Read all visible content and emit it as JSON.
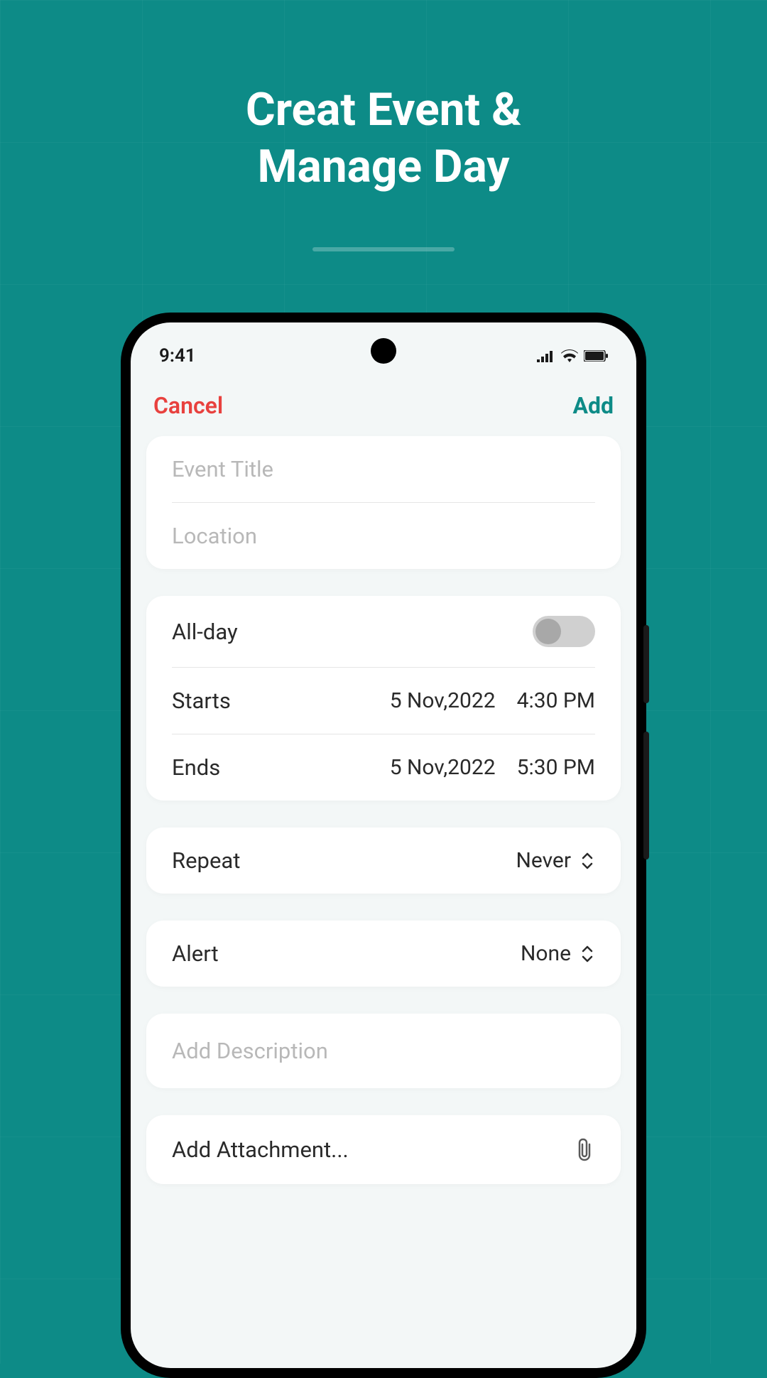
{
  "promo": {
    "headline_line1": "Creat Event &",
    "headline_line2": "Manage Day"
  },
  "status": {
    "time": "9:41"
  },
  "nav": {
    "cancel": "Cancel",
    "add": "Add"
  },
  "fields": {
    "title_placeholder": "Event Title",
    "location_placeholder": "Location",
    "allday_label": "All-day",
    "allday_value": false,
    "starts_label": "Starts",
    "starts_date": "5 Nov,2022",
    "starts_time": "4:30 PM",
    "ends_label": "Ends",
    "ends_date": "5 Nov,2022",
    "ends_time": "5:30 PM",
    "repeat_label": "Repeat",
    "repeat_value": "Never",
    "alert_label": "Alert",
    "alert_value": "None",
    "description_placeholder": "Add Description",
    "attachment_label": "Add Attachment..."
  },
  "colors": {
    "background": "#0d8b87",
    "cancel": "#e8413e",
    "accent": "#0d8b87"
  }
}
